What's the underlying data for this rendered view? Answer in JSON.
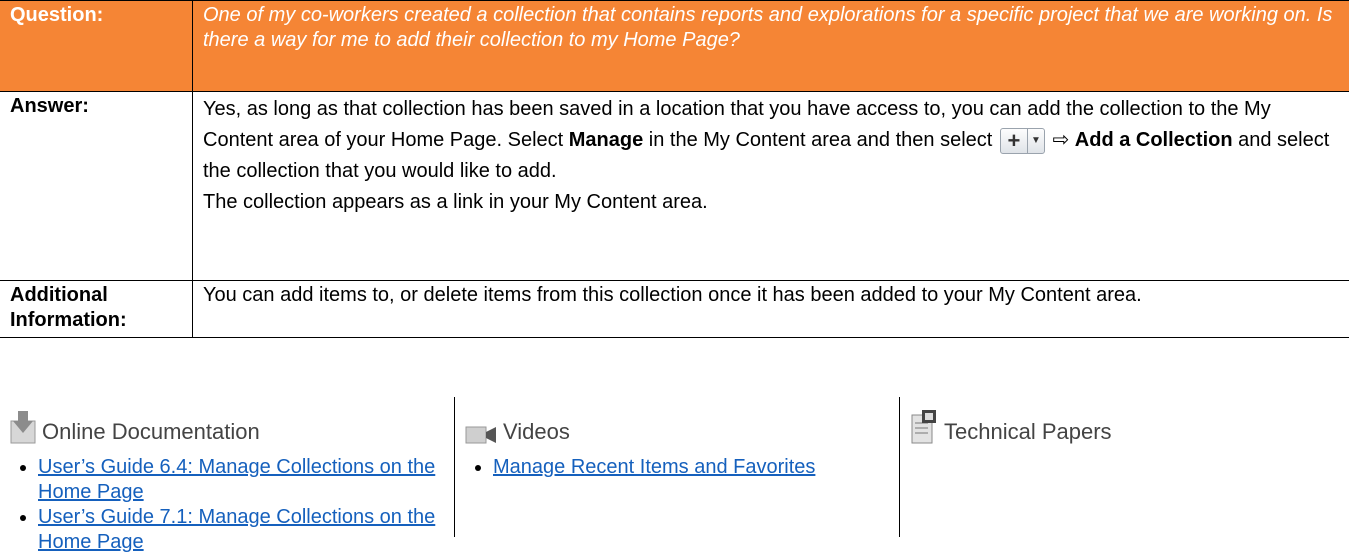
{
  "question": {
    "label": "Question:",
    "text": "One of my co-workers created a collection that contains reports and explorations for a specific project that we are working on.  Is there a way for me to add their collection to my Home Page?"
  },
  "answer": {
    "label": "Answer:",
    "line1": "Yes, as long as that collection has been saved in a location that you have access to, you can add the collection to the My Content area of your Home Page.  Select ",
    "manage": "Manage",
    "line2": " in the My Content area and then select ",
    "arrow": " ⇨ ",
    "add_collection": "Add a Collection",
    "line3": " and select the collection that you would like to add.",
    "line4": "The collection appears as a link in your My Content area."
  },
  "additional": {
    "label": "Additional Information:",
    "text": "You can add items to, or delete items from this collection once it has been added to your My Content area."
  },
  "resources": {
    "documentation": {
      "title": "Online Documentation",
      "links": [
        "User’s Guide 6.4: Manage Collections on the Home Page",
        "User’s Guide 7.1: Manage Collections on the Home Page"
      ]
    },
    "videos": {
      "title": "Videos",
      "links": [
        "Manage Recent Items and Favorites"
      ]
    },
    "papers": {
      "title": "Technical Papers"
    }
  },
  "colors": {
    "header_bg": "#f58535",
    "link": "#1560bd"
  }
}
